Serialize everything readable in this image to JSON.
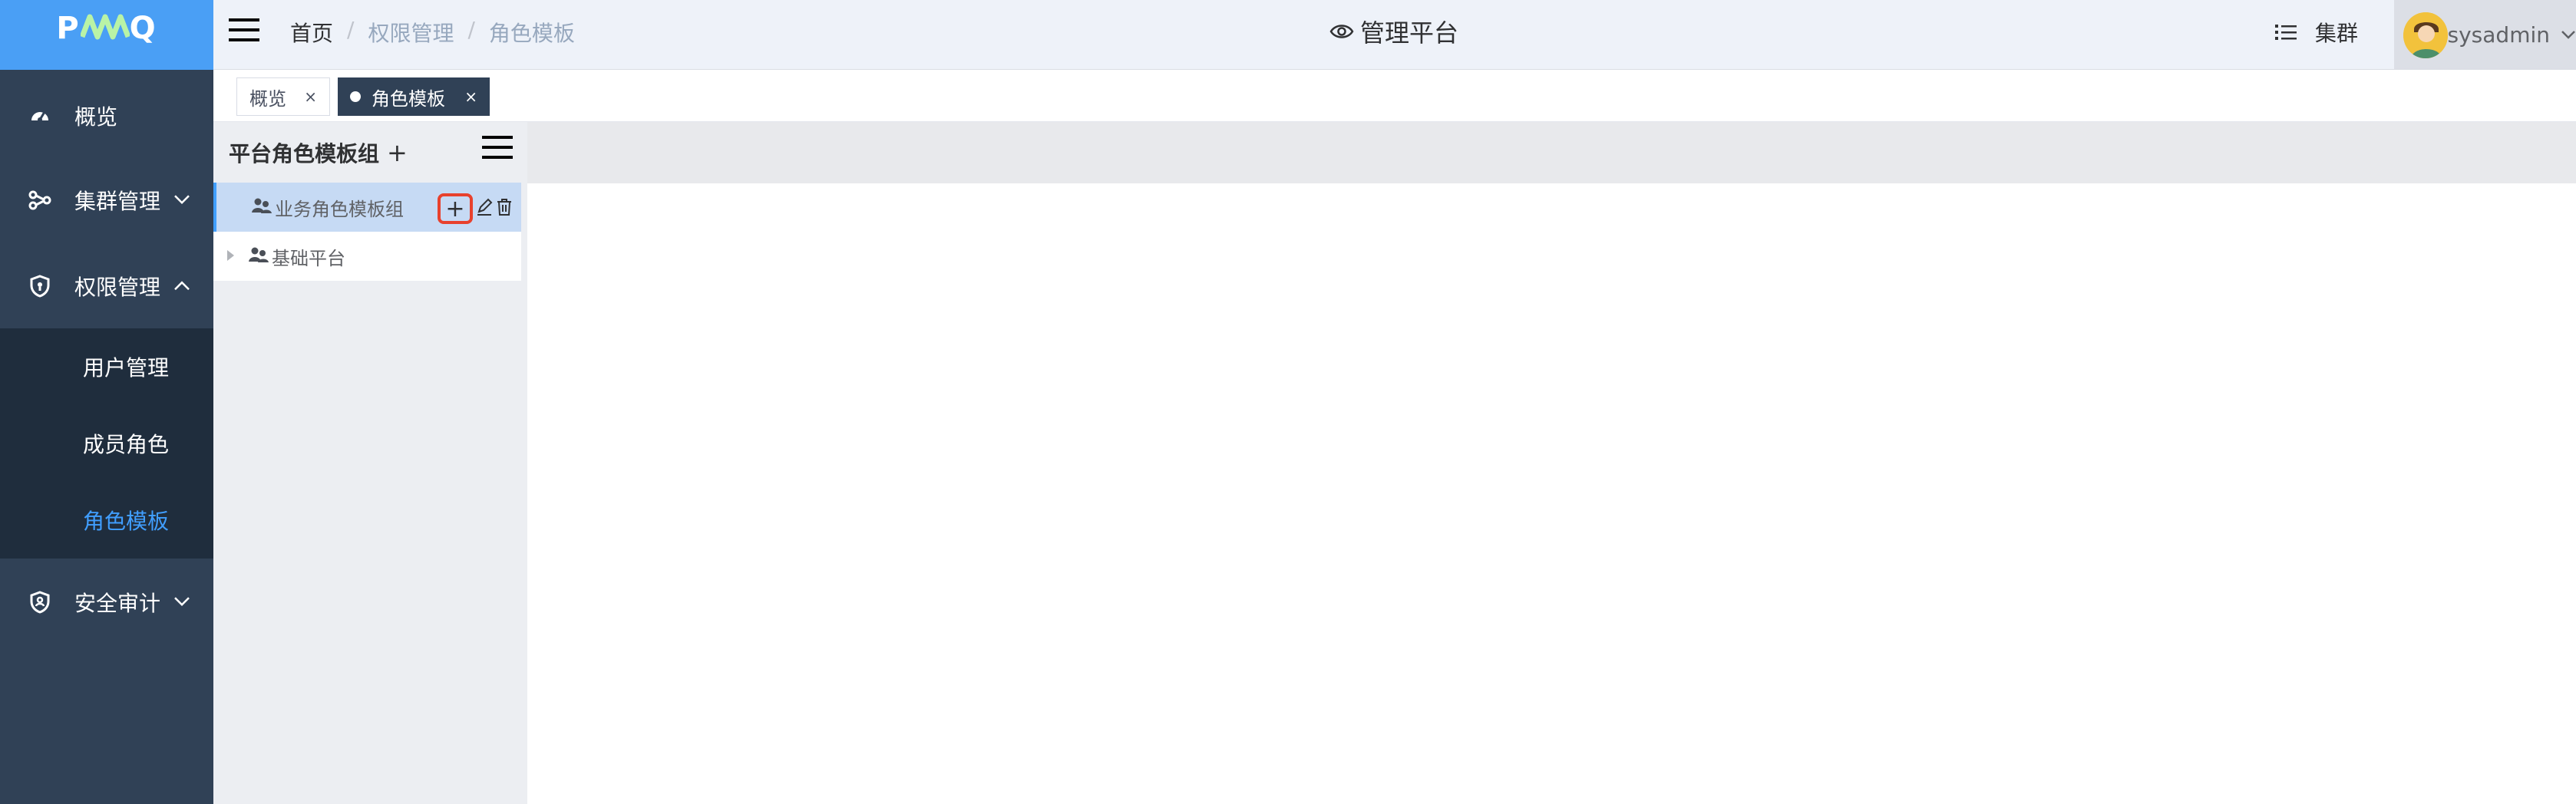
{
  "brand": {
    "logo_left": "P",
    "logo_mid": "AAA",
    "logo_right": "Q"
  },
  "sidebar": {
    "items": [
      {
        "label": "概览",
        "icon": "dashboard-icon"
      },
      {
        "label": "集群管理",
        "icon": "cluster-icon"
      },
      {
        "label": "权限管理",
        "icon": "shield-icon"
      },
      {
        "label": "安全审计",
        "icon": "audit-icon"
      }
    ],
    "submenu": [
      {
        "label": "用户管理"
      },
      {
        "label": "成员角色"
      },
      {
        "label": "角色模板",
        "active": true
      }
    ]
  },
  "header": {
    "breadcrumb": [
      "首页",
      "权限管理",
      "角色模板"
    ],
    "separator": "/",
    "platform_title": "管理平台",
    "cluster_label": "集群",
    "username": "sysadmin"
  },
  "tags": [
    {
      "label": "概览",
      "close": "×",
      "active": false
    },
    {
      "label": "角色模板",
      "close": "×",
      "active": true
    }
  ],
  "tree": {
    "title": "平台角色模板组",
    "add_symbol": "+",
    "nodes": [
      {
        "label": "业务角色模板组",
        "selected": true
      },
      {
        "label": "基础平台",
        "selected": false
      }
    ],
    "node_add_symbol": "+"
  },
  "colors": {
    "sidebar_bg": "#304156",
    "submenu_bg": "#1f2d3d",
    "logo_bg": "#4a9ff5",
    "accent": "#409eff",
    "highlight_border": "#e8412d"
  }
}
